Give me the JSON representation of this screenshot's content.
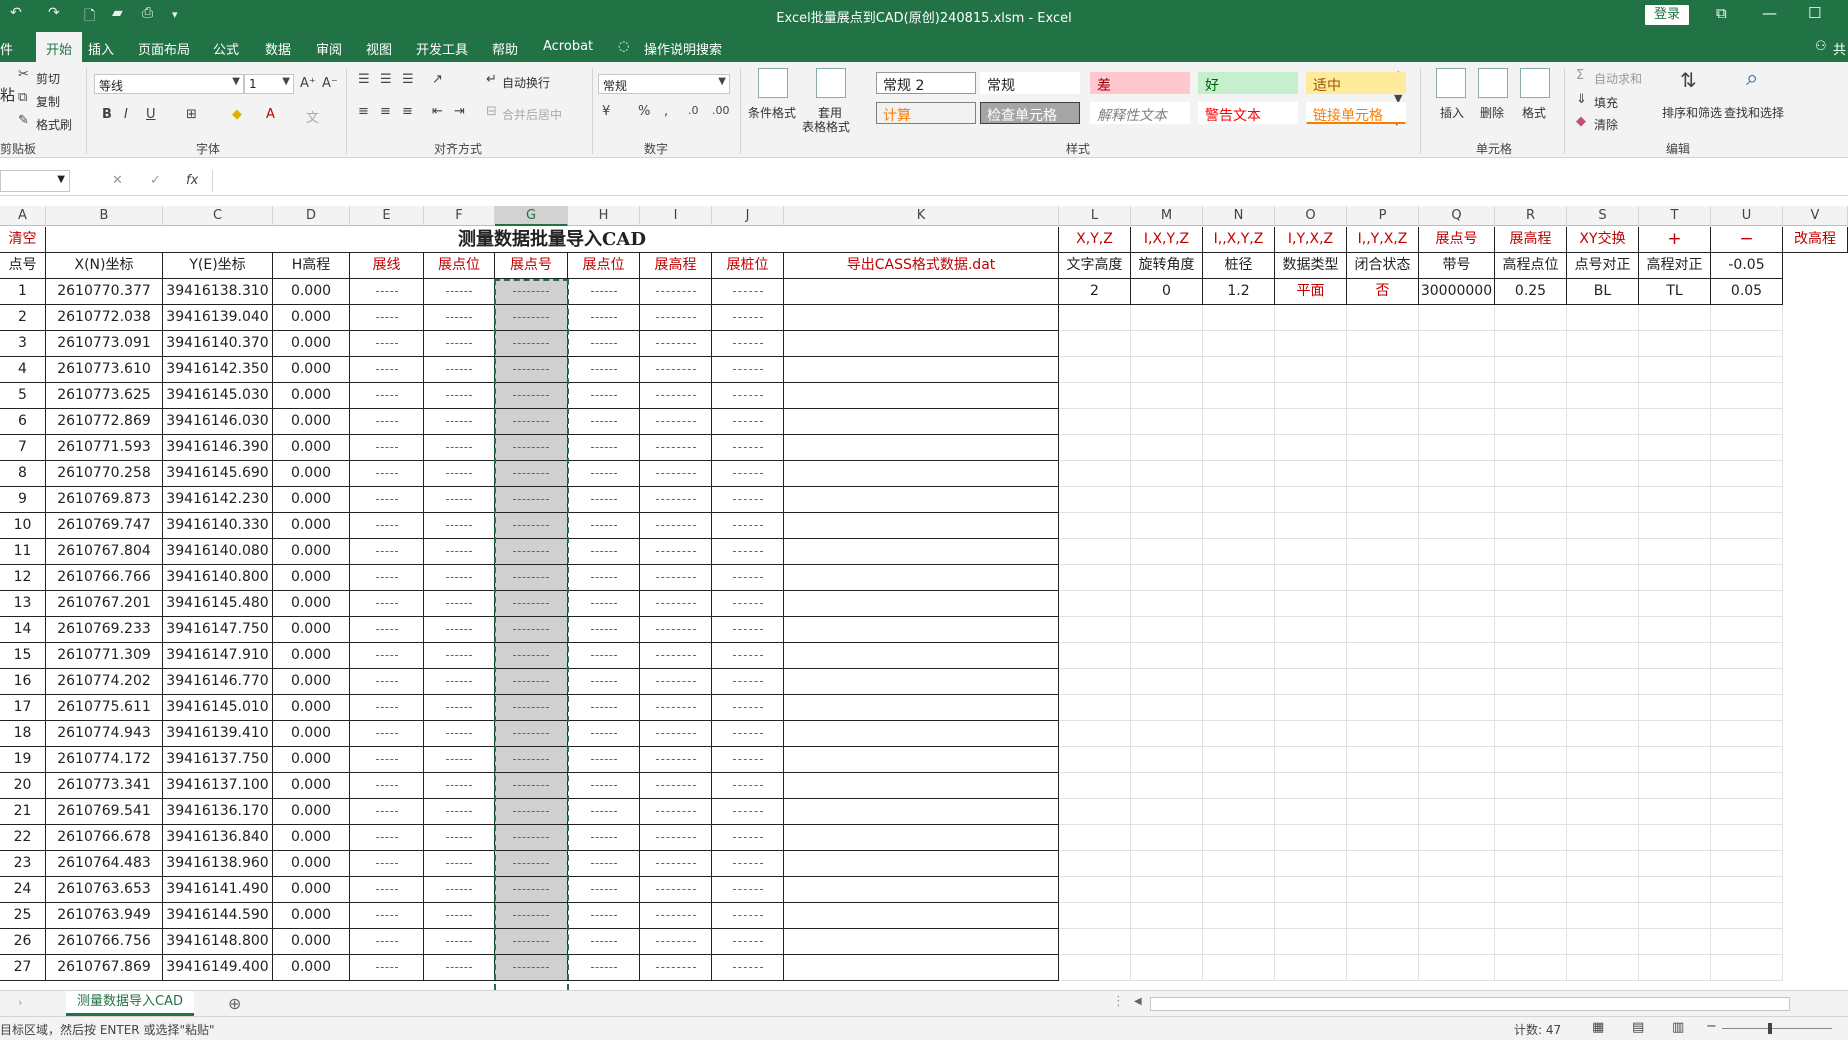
{
  "window": {
    "doc_title": "Excel批量展点到CAD(原创)240815.xlsm  -  Excel",
    "login_label": "登录",
    "controls": [
      "⧉",
      "—",
      "☐"
    ]
  },
  "ribbon_tabs": [
    "件",
    "开始",
    "插入",
    "页面布局",
    "公式",
    "数据",
    "审阅",
    "视图",
    "开发工具",
    "帮助",
    "Acrobat",
    "操作说明搜索"
  ],
  "ribbon_right": "共",
  "clipboard": {
    "cut": "剪切",
    "copy": "复制",
    "format_painter": "格式刷",
    "paste": "粘",
    "group": "剪贴板"
  },
  "font": {
    "name": "等线",
    "size": "1",
    "bold": "B",
    "italic": "I",
    "underline": "U",
    "group": "字体"
  },
  "alignment": {
    "wrap": "自动换行",
    "merge": "合并后居中",
    "group": "对齐方式"
  },
  "number": {
    "format": "常规",
    "percent": "%",
    "comma": ",",
    "group": "数字"
  },
  "styles": {
    "cond_format": "条件格式",
    "table_format": [
      "套用",
      "表格格式"
    ],
    "items": [
      {
        "label": "常规 2",
        "bg": "#ffffff",
        "fg": "#222222",
        "border": "#999999"
      },
      {
        "label": "常规",
        "bg": "#ffffff",
        "fg": "#222222",
        "border": "#ffffff"
      },
      {
        "label": "差",
        "bg": "#ffc7ce",
        "fg": "#9c0006",
        "border": "#ffc7ce"
      },
      {
        "label": "好",
        "bg": "#c6efce",
        "fg": "#006100",
        "border": "#c6efce"
      },
      {
        "label": "适中",
        "bg": "#ffeb9c",
        "fg": "#9c5700",
        "border": "#ffeb9c"
      },
      {
        "label": "计算",
        "bg": "#f2f2f2",
        "fg": "#fa7d00",
        "border": "#7f7f7f"
      },
      {
        "label": "检查单元格",
        "bg": "#a5a5a5",
        "fg": "#ffffff",
        "border": "#3f3f3f"
      },
      {
        "label": "解释性文本",
        "bg": "#ffffff",
        "fg": "#7f7f7f",
        "border": "#ffffff"
      },
      {
        "label": "警告文本",
        "bg": "#ffffff",
        "fg": "#ff0000",
        "border": "#ffffff"
      },
      {
        "label": "链接单元格",
        "bg": "#ffffff",
        "fg": "#fa7d00",
        "border": "#ffffff"
      }
    ],
    "group": "样式"
  },
  "cells": {
    "insert": "插入",
    "delete": "删除",
    "format": "格式",
    "group": "单元格"
  },
  "editing": {
    "autosum": "自动求和",
    "fill": "填充",
    "clear": "清除",
    "sort": "排序和筛选",
    "find": "查找和选择",
    "group": "编辑"
  },
  "formula_bar": {
    "fx": "fx",
    "cancel": "✕",
    "confirm": "✓",
    "value": ""
  },
  "columns": [
    "A",
    "B",
    "C",
    "D",
    "E",
    "F",
    "G",
    "H",
    "I",
    "J",
    "K",
    "L",
    "M",
    "N",
    "O",
    "P",
    "Q",
    "R",
    "S",
    "T",
    "U",
    "V"
  ],
  "row1": {
    "clear": "清空",
    "title": "测量数据批量导入CAD",
    "buttons": [
      "X,Y,Z",
      "I,X,Y,Z",
      "I,,X,Y,Z",
      "I,Y,X,Z",
      "I,,Y,X,Z",
      "展点号",
      "展高程",
      "XY交换",
      "+",
      "−",
      "改高程"
    ]
  },
  "row2": {
    "headers": [
      "点号",
      "X(N)坐标",
      "Y(E)坐标",
      "H高程",
      "展线",
      "展点位",
      "展点号",
      "展点位",
      "展高程",
      "展桩位",
      "导出CASS格式数据.dat"
    ],
    "params": [
      "文字高度",
      "旋转角度",
      "桩径",
      "数据类型",
      "闭合状态",
      "带号",
      "高程点位",
      "点号对正",
      "高程对正",
      "-0.05"
    ]
  },
  "row3_params": [
    "2",
    "0",
    "1.2",
    "平面",
    "否",
    "30000000",
    "0.25",
    "BL",
    "TL",
    "0.05"
  ],
  "data_rows": [
    [
      "1",
      "2610770.377",
      "39416138.310",
      "0.000"
    ],
    [
      "2",
      "2610772.038",
      "39416139.040",
      "0.000"
    ],
    [
      "3",
      "2610773.091",
      "39416140.370",
      "0.000"
    ],
    [
      "4",
      "2610773.610",
      "39416142.350",
      "0.000"
    ],
    [
      "5",
      "2610773.625",
      "39416145.030",
      "0.000"
    ],
    [
      "6",
      "2610772.869",
      "39416146.030",
      "0.000"
    ],
    [
      "7",
      "2610771.593",
      "39416146.390",
      "0.000"
    ],
    [
      "8",
      "2610770.258",
      "39416145.690",
      "0.000"
    ],
    [
      "9",
      "2610769.873",
      "39416142.230",
      "0.000"
    ],
    [
      "10",
      "2610769.747",
      "39416140.330",
      "0.000"
    ],
    [
      "11",
      "2610767.804",
      "39416140.080",
      "0.000"
    ],
    [
      "12",
      "2610766.766",
      "39416140.800",
      "0.000"
    ],
    [
      "13",
      "2610767.201",
      "39416145.480",
      "0.000"
    ],
    [
      "14",
      "2610769.233",
      "39416147.750",
      "0.000"
    ],
    [
      "15",
      "2610771.309",
      "39416147.910",
      "0.000"
    ],
    [
      "16",
      "2610774.202",
      "39416146.770",
      "0.000"
    ],
    [
      "17",
      "2610775.611",
      "39416145.010",
      "0.000"
    ],
    [
      "18",
      "2610774.943",
      "39416139.410",
      "0.000"
    ],
    [
      "19",
      "2610774.172",
      "39416137.750",
      "0.000"
    ],
    [
      "20",
      "2610773.341",
      "39416137.100",
      "0.000"
    ],
    [
      "21",
      "2610769.541",
      "39416136.170",
      "0.000"
    ],
    [
      "22",
      "2610766.678",
      "39416136.840",
      "0.000"
    ],
    [
      "23",
      "2610764.483",
      "39416138.960",
      "0.000"
    ],
    [
      "24",
      "2610763.653",
      "39416141.490",
      "0.000"
    ],
    [
      "25",
      "2610763.949",
      "39416144.590",
      "0.000"
    ],
    [
      "26",
      "2610766.756",
      "39416148.800",
      "0.000"
    ],
    [
      "27",
      "2610767.869",
      "39416149.400",
      "0.000"
    ]
  ],
  "sheet_tab": "测量数据导入CAD",
  "status": {
    "message": "目标区域，然后按 ENTER 或选择\"粘贴\"",
    "count": "计数: 47"
  },
  "colors": {
    "accent": "#217346",
    "red_text": "#c00000"
  }
}
